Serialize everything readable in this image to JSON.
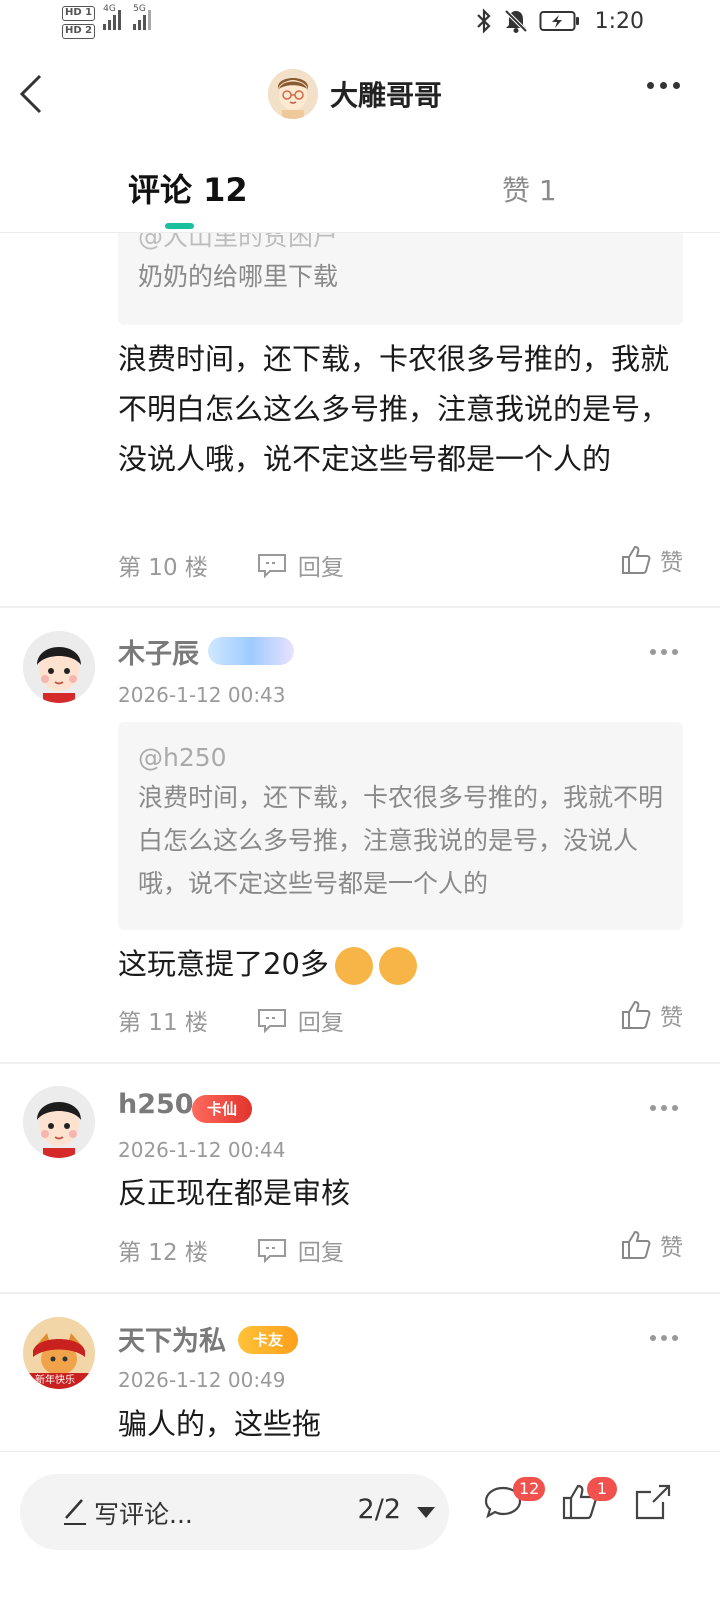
{
  "status_bar": {
    "sim1": "HD 1",
    "sim2": "HD 2",
    "net1": "4G",
    "net2": "5G",
    "time": "1:20"
  },
  "header": {
    "title": "大雕哥哥"
  },
  "tabs": {
    "comments_label": "评论 12",
    "likes_label": "赞 1"
  },
  "comments": [
    {
      "quote_user": "@大山里的贫困户",
      "quote_text": "奶奶的给哪里下载",
      "text": "浪费时间，还下载，卡农很多号推的，我就不明白怎么这么多号推，注意我说的是号，没说人哦，说不定这些号都是一个人的",
      "floor": "第 10 楼",
      "reply_label": "回复",
      "like_label": "赞"
    },
    {
      "name": "木子辰",
      "time": "2026-1-12 00:43",
      "quote_user": "@h250",
      "quote_text": "浪费时间，还下载，卡农很多号推的，我就不明白怎么这么多号推，注意我说的是号，没说人哦，说不定这些号都是一个人的",
      "text": "这玩意提了20多",
      "floor": "第 11 楼",
      "reply_label": "回复",
      "like_label": "赞"
    },
    {
      "name": "h250",
      "badge": "卡仙",
      "time": "2026-1-12 00:44",
      "text": "反正现在都是审核",
      "floor": "第 12 楼",
      "reply_label": "回复",
      "like_label": "赞"
    },
    {
      "name": "天下为私",
      "badge": "卡友",
      "avatar_caption": "新年快乐",
      "time": "2026-1-12 00:49",
      "text": "骗人的，这些拖"
    }
  ],
  "bottom_bar": {
    "write_placeholder": "写评论...",
    "pager": "2/2",
    "comment_count": "12",
    "like_count": "1"
  },
  "colors": {
    "accent": "#1bbf9e",
    "badge_red": "#f2524d"
  }
}
